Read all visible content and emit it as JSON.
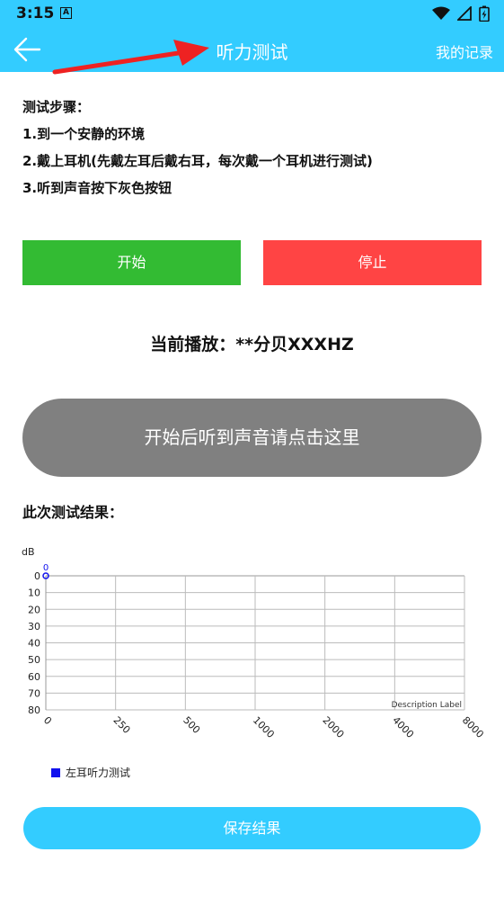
{
  "status_bar": {
    "time": "3:15",
    "notification_glyph": "A"
  },
  "app_bar": {
    "title": "听力测试",
    "records_label": "我的记录"
  },
  "steps": {
    "heading": "测试步骤：",
    "items": [
      "1.到一个安静的环境",
      "2.戴上耳机(先戴左耳后戴右耳，每次戴一个耳机进行测试)",
      "3.听到声音按下灰色按钮"
    ]
  },
  "controls": {
    "start_label": "开始",
    "stop_label": "停止"
  },
  "now_playing": "当前播放：**分贝XXXHZ",
  "tap_button_label": "开始后听到声音请点击这里",
  "results_title": "此次测试结果：",
  "chart_data": {
    "type": "line",
    "ylabel": "dB",
    "y_ticks": [
      "0",
      "10",
      "20",
      "30",
      "40",
      "50",
      "60",
      "70",
      "80"
    ],
    "ylim": [
      0,
      80
    ],
    "y_inverted": true,
    "x_categories": [
      "0",
      "250",
      "500",
      "1000",
      "2000",
      "4000",
      "8000"
    ],
    "description_label": "Description Label",
    "series": [
      {
        "name": "左耳听力测试",
        "color": "#1111ee",
        "points": [
          {
            "x": "0",
            "y": 0
          }
        ]
      }
    ],
    "data_labels": [
      "0"
    ]
  },
  "legend": {
    "label": "左耳听力测试",
    "color": "#1111ee"
  },
  "save_label": "保存结果",
  "colors": {
    "accent": "#33ccff",
    "start": "#33bb33",
    "stop": "#ff4444",
    "tap": "#808080",
    "annotation_arrow": "#ee2222"
  }
}
